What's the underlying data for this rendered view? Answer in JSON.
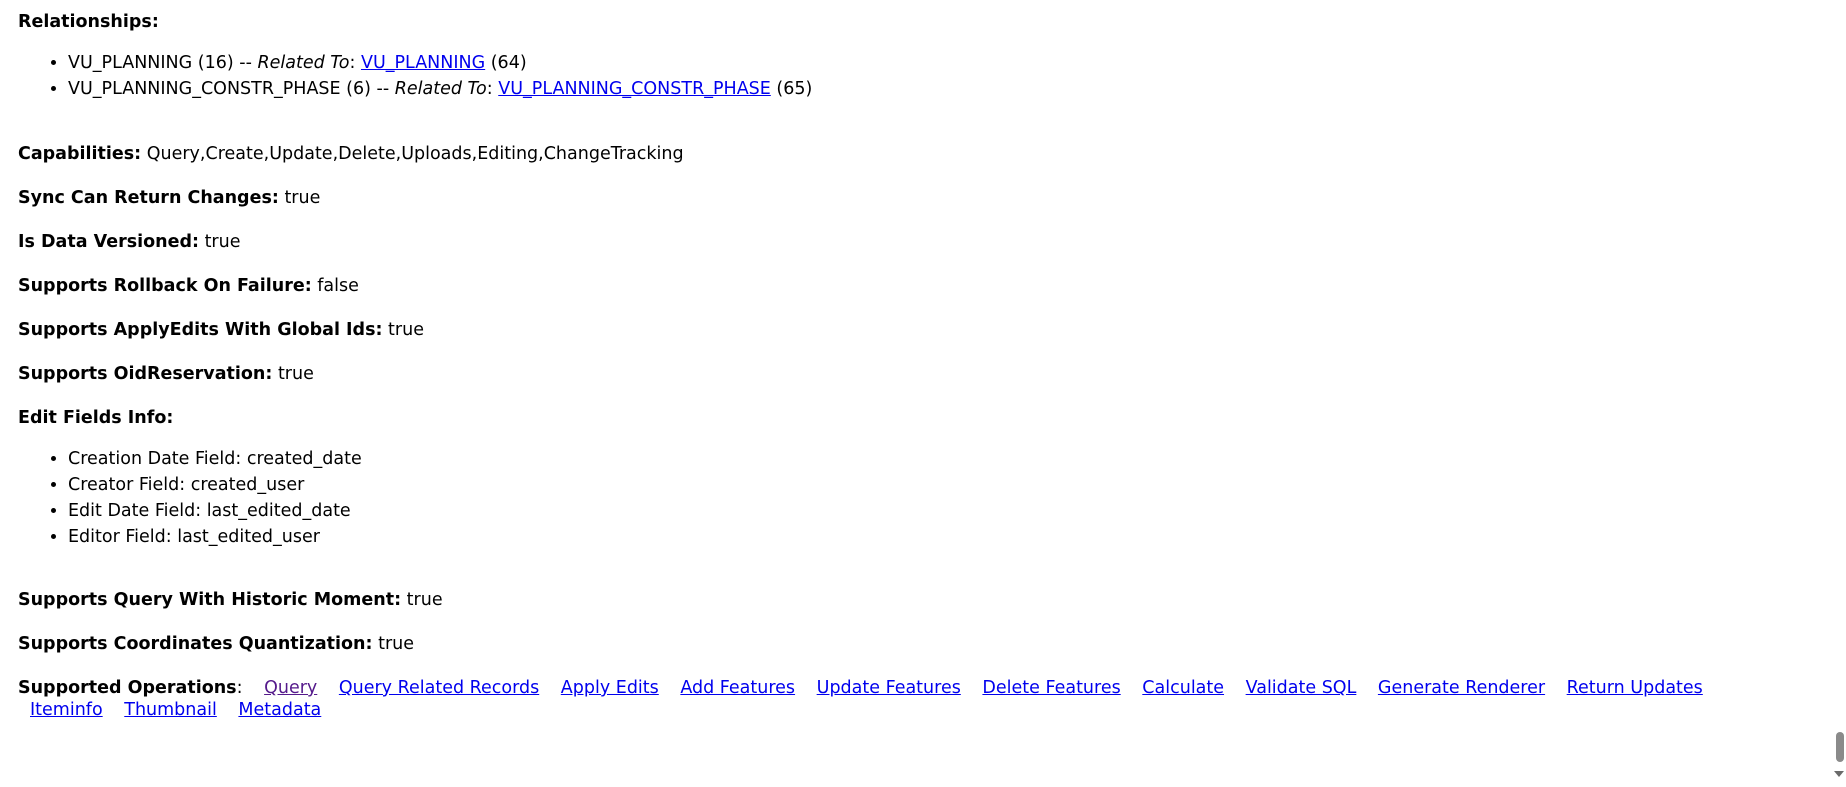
{
  "relationships": {
    "heading": "Relationships:",
    "items": [
      {
        "name_id": "VU_PLANNING (16)",
        "sep": " -- ",
        "related_label": "Related To",
        "colon": ": ",
        "link": "VU_PLANNING",
        "link_id": " (64)"
      },
      {
        "name_id": "VU_PLANNING_CONSTR_PHASE (6)",
        "sep": " -- ",
        "related_label": "Related To",
        "colon": ": ",
        "link": "VU_PLANNING_CONSTR_PHASE",
        "link_id": " (65)"
      }
    ]
  },
  "properties": {
    "capabilities": {
      "label": "Capabilities:",
      "value": " Query,Create,Update,Delete,Uploads,Editing,ChangeTracking"
    },
    "sync_changes": {
      "label": "Sync Can Return Changes:",
      "value": " true"
    },
    "data_versioned": {
      "label": "Is Data Versioned:",
      "value": " true"
    },
    "rollback": {
      "label": "Supports Rollback On Failure:",
      "value": " false"
    },
    "global_ids": {
      "label": "Supports ApplyEdits With Global Ids:",
      "value": " true"
    },
    "oid_reservation": {
      "label": "Supports OidReservation:",
      "value": " true"
    },
    "historic_moment": {
      "label": "Supports Query With Historic Moment:",
      "value": " true"
    },
    "quantization": {
      "label": "Supports Coordinates Quantization:",
      "value": " true"
    }
  },
  "edit_fields": {
    "heading": "Edit Fields Info:",
    "items": [
      "Creation Date Field: created_date",
      "Creator Field: created_user",
      "Edit Date Field: last_edited_date",
      "Editor Field: last_edited_user"
    ]
  },
  "operations": {
    "label": "Supported Operations",
    "colon": ":",
    "links_row1": [
      "Query",
      "Query Related Records",
      "Apply Edits",
      "Add Features",
      "Update Features",
      "Delete Features",
      "Calculate",
      "Validate SQL",
      "Generate Renderer",
      "Return Updates"
    ],
    "links_row2": [
      "Iteminfo",
      "Thumbnail",
      "Metadata"
    ]
  },
  "colors": {
    "link": "#0000ee",
    "visited_link": "#551a8b",
    "text": "#000000",
    "background": "#ffffff"
  }
}
